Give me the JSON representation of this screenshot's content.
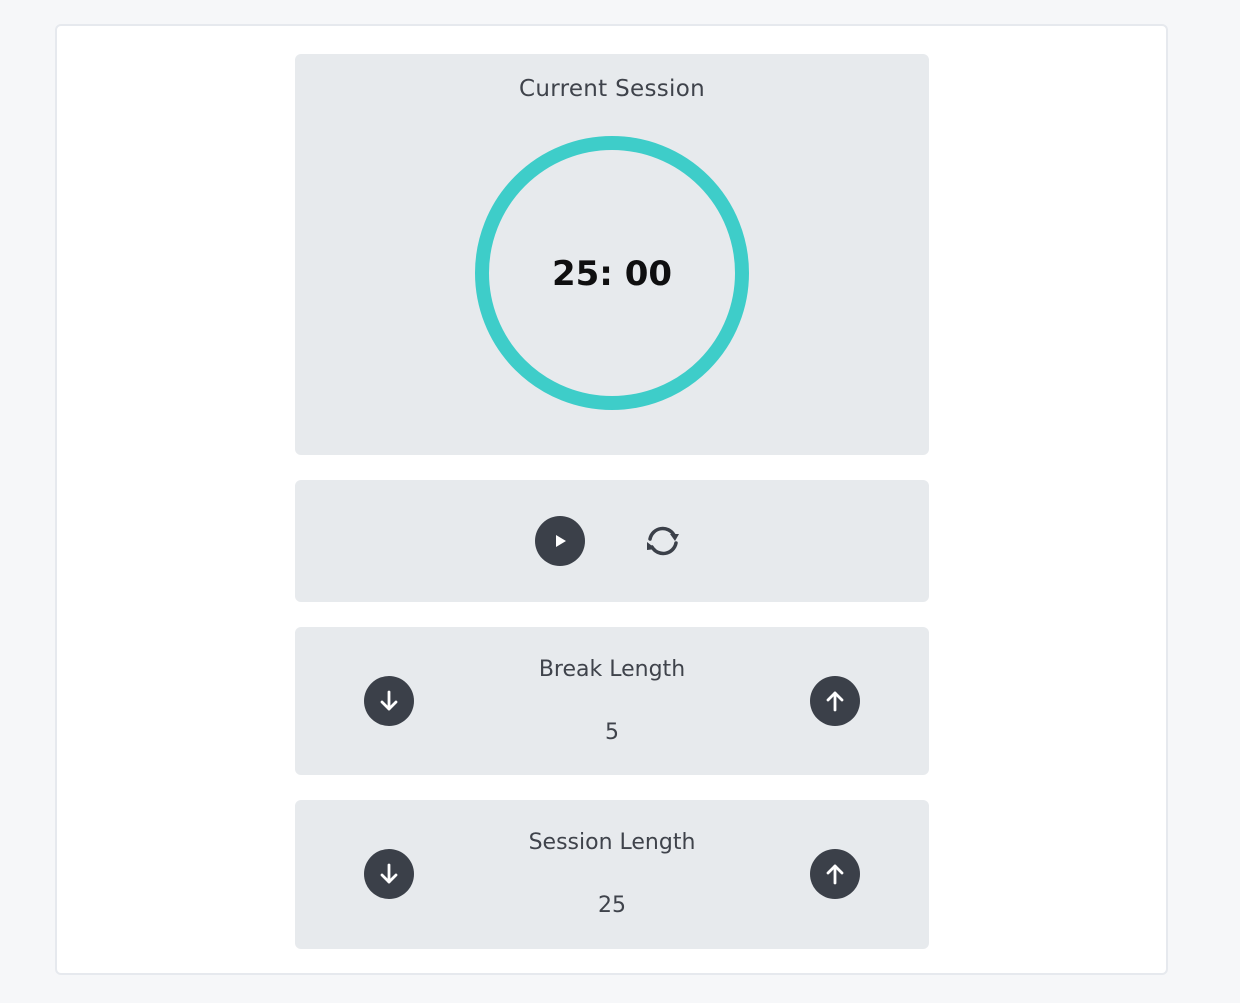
{
  "session": {
    "title": "Current Session",
    "time": "25: 00"
  },
  "controls": {
    "play_icon": "play-icon",
    "reset_icon": "refresh-icon"
  },
  "break_length": {
    "label": "Break Length",
    "value": "5"
  },
  "session_length": {
    "label": "Session Length",
    "value": "25"
  },
  "colors": {
    "ring": "#3ecdc9",
    "button": "#3b4049",
    "panel": "#e7eaed"
  }
}
